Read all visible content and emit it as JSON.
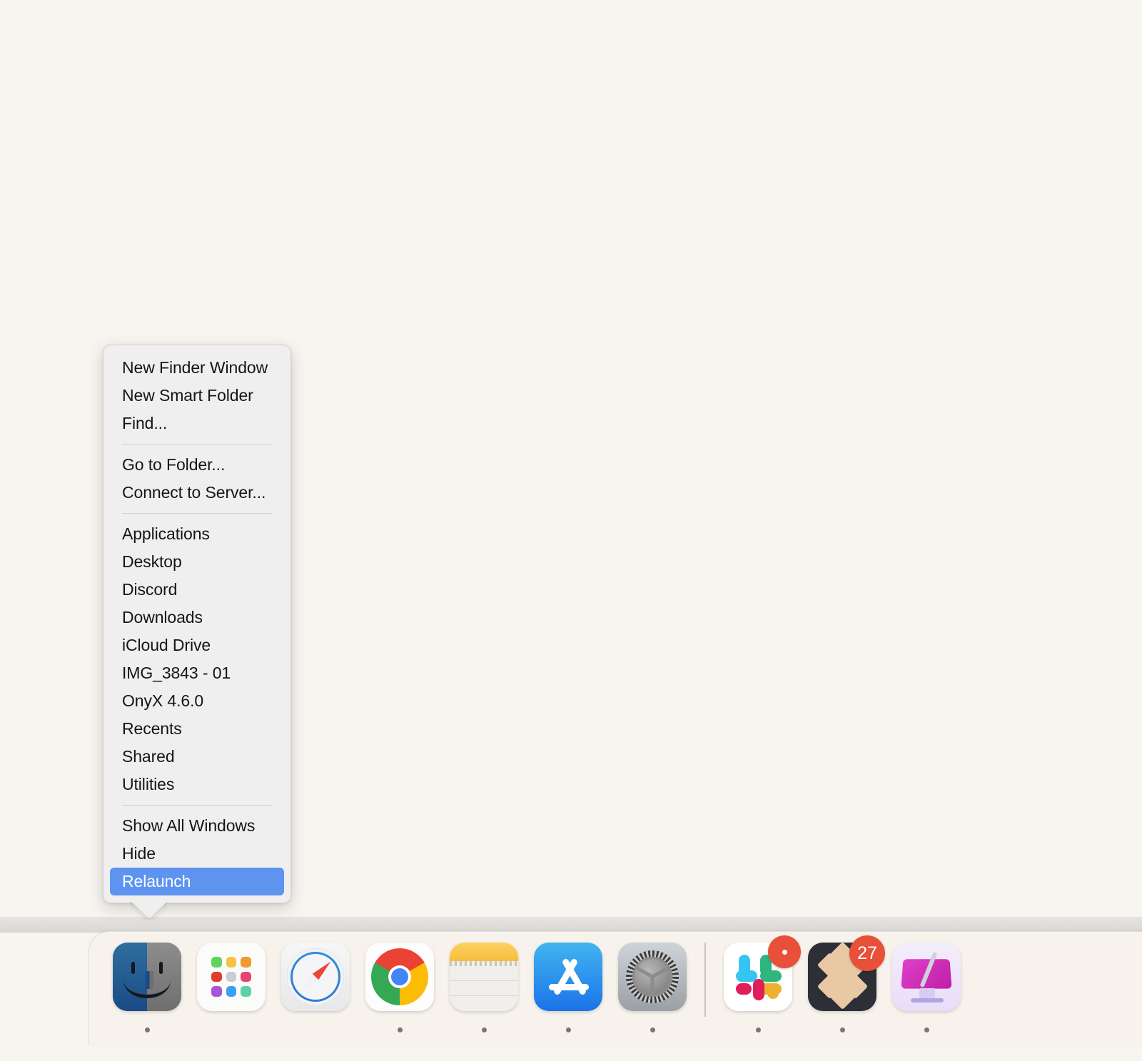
{
  "desktop": {
    "background_color": "#f8f5f0"
  },
  "context_menu": {
    "name": "finder-dock-context-menu",
    "background_color": "#efefef",
    "highlight_color": "#5e93f0",
    "highlight_text_color": "#ffffff",
    "sections": [
      {
        "items": [
          {
            "label": "New Finder Window",
            "selected": false
          },
          {
            "label": "New Smart Folder",
            "selected": false
          },
          {
            "label": "Find...",
            "selected": false
          }
        ]
      },
      {
        "items": [
          {
            "label": "Go to Folder...",
            "selected": false
          },
          {
            "label": "Connect to Server...",
            "selected": false
          }
        ]
      },
      {
        "items": [
          {
            "label": "Applications",
            "selected": false
          },
          {
            "label": "Desktop",
            "selected": false
          },
          {
            "label": "Discord",
            "selected": false
          },
          {
            "label": "Downloads",
            "selected": false
          },
          {
            "label": "iCloud Drive",
            "selected": false
          },
          {
            "label": "IMG_3843 - 01",
            "selected": false
          },
          {
            "label": "OnyX 4.6.0",
            "selected": false
          },
          {
            "label": "Recents",
            "selected": false
          },
          {
            "label": "Shared",
            "selected": false
          },
          {
            "label": "Utilities",
            "selected": false
          }
        ]
      },
      {
        "items": [
          {
            "label": "Show All Windows",
            "selected": false
          },
          {
            "label": "Hide",
            "selected": false
          },
          {
            "label": "Relaunch",
            "selected": true
          }
        ]
      }
    ]
  },
  "dock": {
    "background_color": "#f7f3ec",
    "items": [
      {
        "name": "finder",
        "icon": "finder-icon",
        "running": true,
        "badge": null
      },
      {
        "name": "launchpad",
        "icon": "launchpad-icon",
        "running": false,
        "badge": null
      },
      {
        "name": "safari",
        "icon": "safari-icon",
        "running": false,
        "badge": null
      },
      {
        "name": "chrome",
        "icon": "chrome-icon",
        "running": true,
        "badge": null
      },
      {
        "name": "notes",
        "icon": "notes-icon",
        "running": true,
        "badge": null
      },
      {
        "name": "app-store",
        "icon": "app-store-icon",
        "running": true,
        "badge": null
      },
      {
        "name": "system-settings",
        "icon": "system-settings-icon",
        "running": true,
        "badge": null
      },
      {
        "name": "divider",
        "icon": "divider",
        "running": false,
        "badge": null
      },
      {
        "name": "slack",
        "icon": "slack-icon",
        "running": true,
        "badge": ""
      },
      {
        "name": "dropbox",
        "icon": "dropbox-icon",
        "running": true,
        "badge": "27"
      },
      {
        "name": "display-cleaner",
        "icon": "display-icon",
        "running": true,
        "badge": null
      }
    ],
    "badge_color": "#e8503a",
    "badge_text_color": "#ffffff"
  },
  "launchpad_tiles": [
    "#5fd35f",
    "#f5c242",
    "#f09a2e",
    "#e03c31",
    "#c9ccd1",
    "#e8436c",
    "#a855d6",
    "#3aa0f5",
    "#5fd1a8"
  ],
  "slack_blades": [
    {
      "color": "#36c5f0"
    },
    {
      "color": "#2eb67d"
    },
    {
      "color": "#ecb22e"
    },
    {
      "color": "#e01e5a"
    }
  ]
}
